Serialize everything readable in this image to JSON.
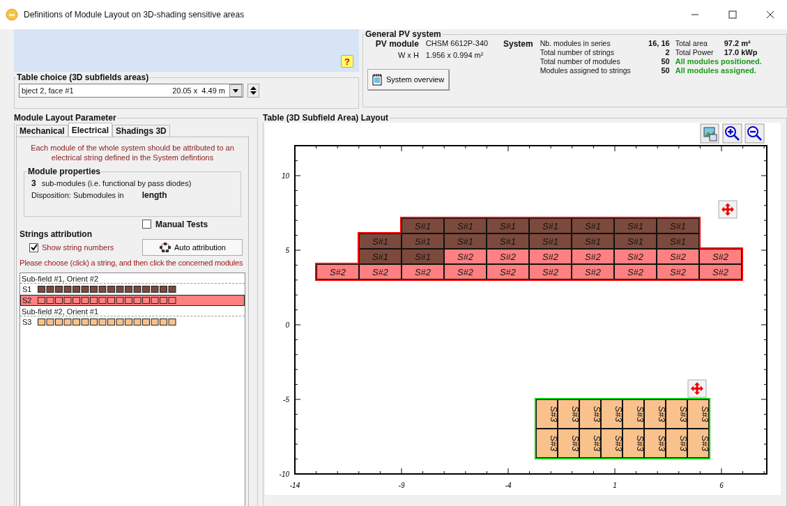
{
  "window": {
    "title": "Definitions of Module Layout on 3D-shading sensitive areas"
  },
  "info_panel": {
    "help_button": "?"
  },
  "table_choice": {
    "title": "Table choice  (3D subfields areas)",
    "value": "bject 2, face #1",
    "size": "20.05 x  4.49 m"
  },
  "pv_system": {
    "title": "General PV system",
    "module_label": "PV module",
    "module_name": "CHSM 6612P-340",
    "size_label": "W x H",
    "size_value": "1.956 x 0.994 m²",
    "system_label": "System",
    "overview_button": "System overview",
    "rows": [
      {
        "label": "Nb. modules in series",
        "value": "16, 16",
        "extra_label": "Total area",
        "extra_value": "97.2 m²"
      },
      {
        "label": "Total number of strings",
        "value": "2",
        "extra_label": "Total Power",
        "extra_value": "17.0 kWp"
      },
      {
        "label": "Total number of modules",
        "value": "50",
        "status": "All modules positioned."
      },
      {
        "label": "Modules assigned to strings",
        "value": "50",
        "status": "All modules assigned."
      }
    ]
  },
  "layout_parameter": {
    "title": "Module Layout Parameter",
    "tabs": [
      {
        "label": "Mechanical",
        "selected": false
      },
      {
        "label": "Electrical",
        "selected": true
      },
      {
        "label": "Shadings 3D",
        "selected": false
      }
    ],
    "message": "Each module of the whole system should be attributed to an electrical string defined in the System defintions",
    "module_properties": {
      "title": "Module properties",
      "count": "3",
      "description": "sub-modules (i.e. functional by pass diodes)",
      "disposition_label": "Disposition:  Submodules in",
      "disposition_value": "length"
    },
    "manual_tests": {
      "label": "Manual Tests",
      "checked": false
    },
    "strings_title": "Strings attribution",
    "show_numbers": {
      "label": "Show string numbers",
      "checked": true
    },
    "auto_button": "Auto attribution",
    "instruction": "Please choose (click) a string, and then click the concerned modules",
    "string_groups": [
      {
        "title": "Sub-field #1, Orient #2",
        "strings": [
          {
            "name": "S1",
            "selected": false,
            "filled": true,
            "color": "#7b4a3c"
          },
          {
            "name": "S2",
            "selected": true,
            "filled": false,
            "color": "#ff8080"
          }
        ]
      },
      {
        "title": "Sub-field #2, Orient #1",
        "strings": [
          {
            "name": "S3",
            "selected": false,
            "filled": true,
            "color": "#f9c18c"
          }
        ]
      }
    ]
  },
  "layout_view": {
    "title": "Table (3D Subfield Area) Layout",
    "x_ticks": [
      "-14",
      "-9",
      "-4",
      "1",
      "6"
    ],
    "y_ticks": [
      "10",
      "5",
      "0",
      "-5",
      "-10"
    ],
    "tables": [
      {
        "color": "#ff0000",
        "vertical": false,
        "rows": [
          {
            "cells": [
              null,
              null,
              {
                "label": "S#1",
                "kind": "first"
              },
              {
                "label": "S#1",
                "kind": "first"
              },
              {
                "label": "S#1",
                "kind": "first"
              },
              {
                "label": "S#1",
                "kind": "first"
              },
              {
                "label": "S#1",
                "kind": "first"
              },
              {
                "label": "S#1",
                "kind": "first"
              },
              {
                "label": "S#1",
                "kind": "first"
              },
              null
            ]
          },
          {
            "cells": [
              null,
              {
                "label": "S#1",
                "kind": "first"
              },
              {
                "label": "S#1",
                "kind": "first"
              },
              {
                "label": "S#1",
                "kind": "first"
              },
              {
                "label": "S#1",
                "kind": "first"
              },
              {
                "label": "S#1",
                "kind": "first"
              },
              {
                "label": "S#1",
                "kind": "first"
              },
              {
                "label": "S#1",
                "kind": "first"
              },
              {
                "label": "S#1",
                "kind": "first"
              },
              null
            ]
          },
          {
            "cells": [
              null,
              {
                "label": "S#1",
                "kind": "first"
              },
              {
                "label": "S#1",
                "kind": "first"
              },
              {
                "label": "S#2",
                "kind": "second"
              },
              {
                "label": "S#2",
                "kind": "second"
              },
              {
                "label": "S#2",
                "kind": "second"
              },
              {
                "label": "S#2",
                "kind": "second"
              },
              {
                "label": "S#2",
                "kind": "second"
              },
              {
                "label": "S#2",
                "kind": "second"
              },
              {
                "label": "S#2",
                "kind": "second"
              }
            ]
          },
          {
            "cells": [
              {
                "label": "S#2",
                "kind": "second"
              },
              {
                "label": "S#2",
                "kind": "second"
              },
              {
                "label": "S#2",
                "kind": "second"
              },
              {
                "label": "S#2",
                "kind": "second"
              },
              {
                "label": "S#2",
                "kind": "second"
              },
              {
                "label": "S#2",
                "kind": "second"
              },
              {
                "label": "S#2",
                "kind": "second"
              },
              {
                "label": "S#2",
                "kind": "second"
              },
              {
                "label": "S#2",
                "kind": "second"
              },
              {
                "label": "S#2",
                "kind": "second"
              }
            ]
          }
        ]
      },
      {
        "color": "#00cc00",
        "vertical": true,
        "rows": [
          {
            "cells": [
              {
                "label": "S#3",
                "kind": "third"
              },
              {
                "label": "S#3",
                "kind": "third"
              },
              {
                "label": "S#3",
                "kind": "third"
              },
              {
                "label": "S#3",
                "kind": "third"
              },
              {
                "label": "S#3",
                "kind": "third"
              },
              {
                "label": "S#3",
                "kind": "third"
              },
              {
                "label": "S#3",
                "kind": "third"
              },
              {
                "label": "S#3",
                "kind": "third"
              }
            ]
          },
          {
            "cells": [
              {
                "label": "S#3",
                "kind": "third"
              },
              {
                "label": "S#3",
                "kind": "third"
              },
              {
                "label": "S#3",
                "kind": "third"
              },
              {
                "label": "S#3",
                "kind": "third"
              },
              {
                "label": "S#3",
                "kind": "third"
              },
              {
                "label": "S#3",
                "kind": "third"
              },
              {
                "label": "S#3",
                "kind": "third"
              },
              {
                "label": "S#3",
                "kind": "third"
              }
            ]
          }
        ]
      }
    ]
  }
}
